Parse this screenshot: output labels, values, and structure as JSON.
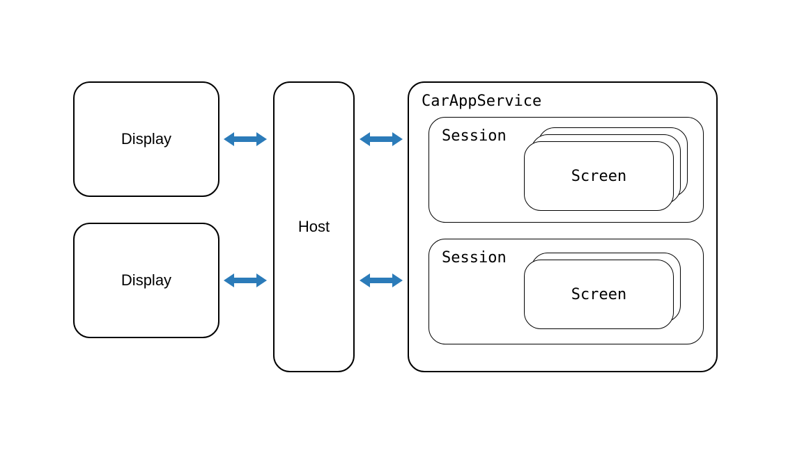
{
  "display1": "Display",
  "display2": "Display",
  "host": "Host",
  "service": "CarAppService",
  "session1": "Session",
  "session2": "Session",
  "screen1": "Screen",
  "screen2": "Screen",
  "arrow_color": "#2b7bb9"
}
